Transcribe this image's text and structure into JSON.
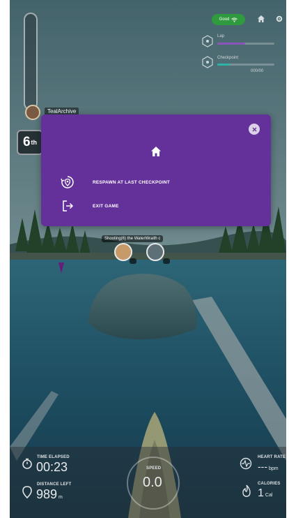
{
  "hud": {
    "player_name": "TealArchive",
    "rank": "6",
    "rank_suffix": "th",
    "connection_label": "Good",
    "course_progress": 0.0,
    "stats_right_top": [
      "Lap",
      "Checkpoint"
    ],
    "stats_right_value": "000/00"
  },
  "nearby": {
    "names_strip": "Shooting(6) the WaterWraith c"
  },
  "bottom_hud": {
    "time_label": "TIME ELAPSED",
    "time_value": "00:23",
    "distance_label": "DISTANCE LEFT",
    "distance_value": "989",
    "distance_unit": "m",
    "speed_label": "SPEED",
    "speed_value": "0.0",
    "heart_label": "HEART RATE",
    "heart_value": "---",
    "heart_unit": "bpm",
    "calories_label": "CALORIES",
    "calories_value": "1",
    "calories_unit": "Cal"
  },
  "menu": {
    "respawn_label": "RESPAWN AT LAST CHECKPOINT",
    "exit_label": "EXIT GAME",
    "background": "#64309a"
  },
  "icons": {
    "close": "close-icon",
    "home": "home-icon",
    "respawn": "respawn-icon",
    "exit": "exit-icon"
  }
}
